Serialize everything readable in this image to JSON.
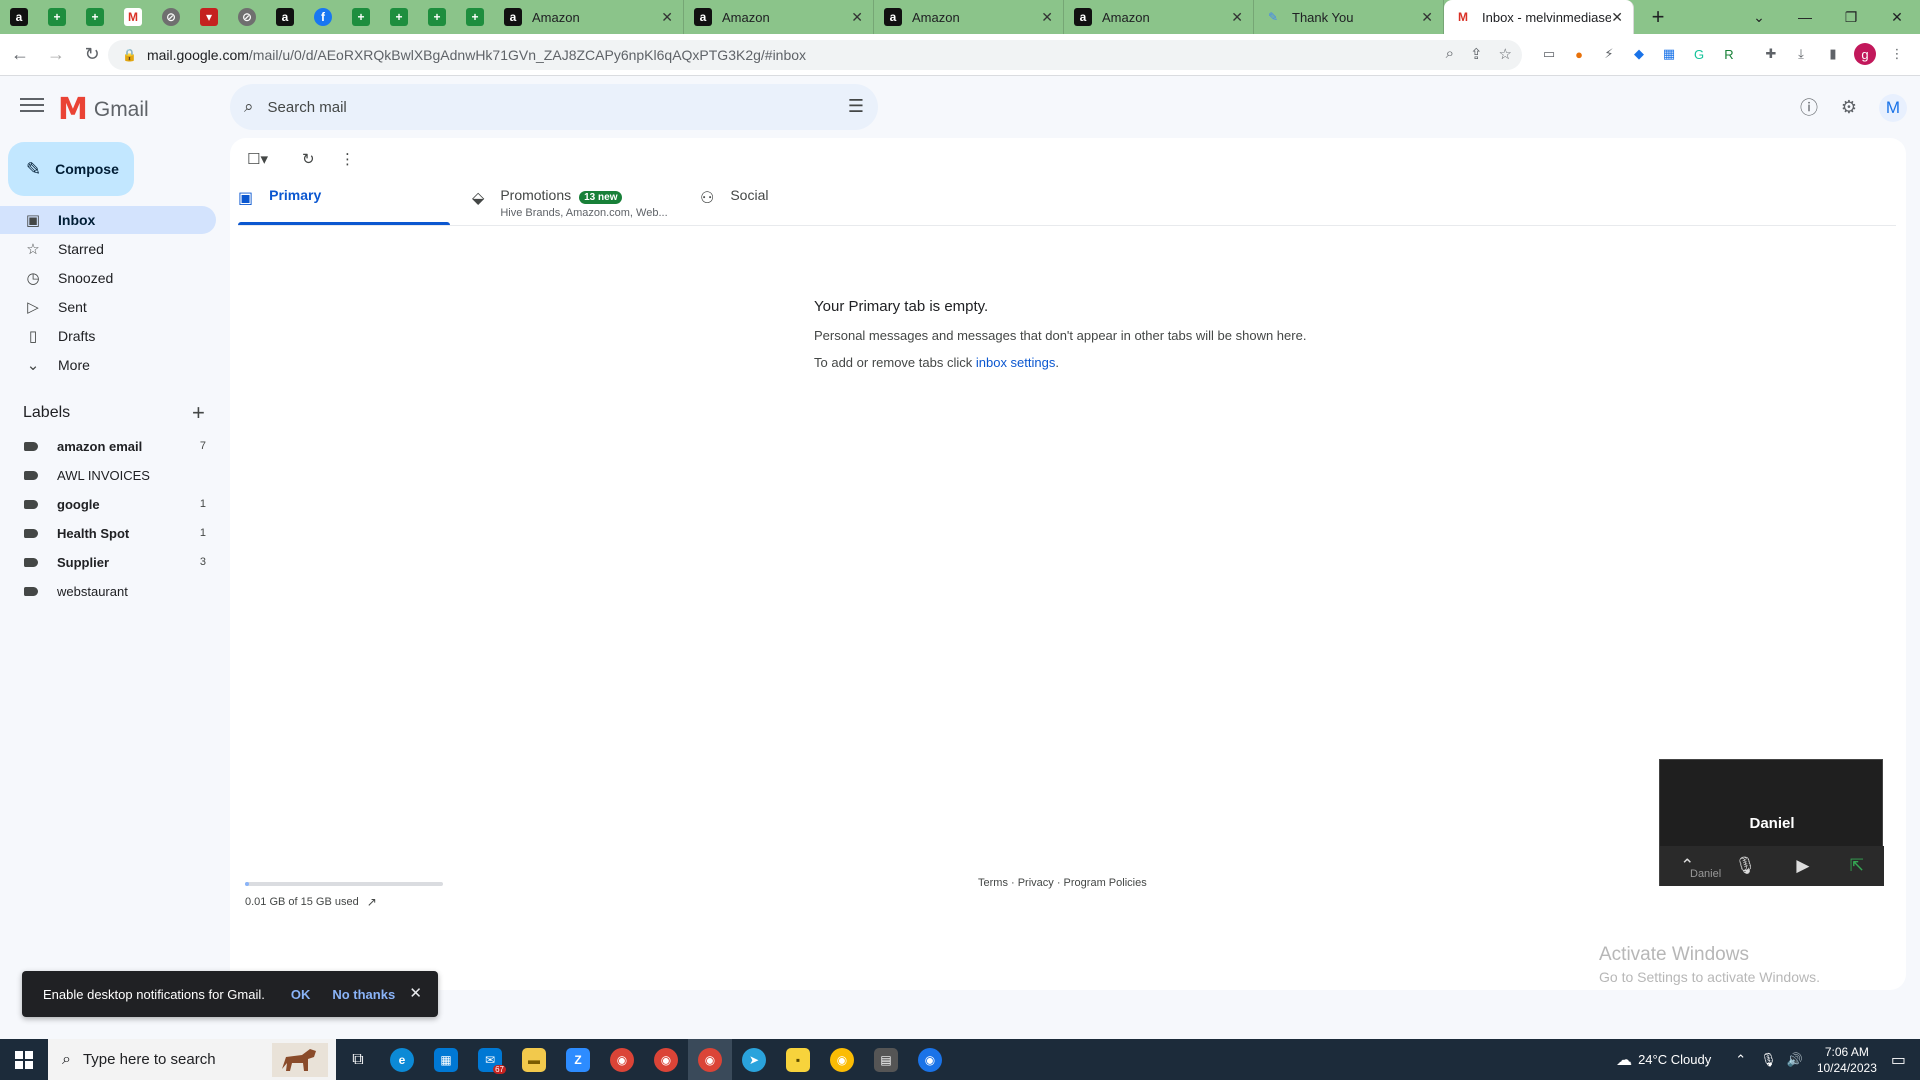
{
  "browser": {
    "pinned_tabs": [
      {
        "icon": "amazon-icon",
        "glyph": "a"
      },
      {
        "icon": "sheets-icon",
        "glyph": "+"
      },
      {
        "icon": "sheets-icon",
        "glyph": "+"
      },
      {
        "icon": "gmail-icon",
        "glyph": "M"
      },
      {
        "icon": "blocked-icon",
        "glyph": "⊘"
      },
      {
        "icon": "red-app-icon",
        "glyph": "▾"
      },
      {
        "icon": "blocked-icon",
        "glyph": "⊘"
      },
      {
        "icon": "amazon-icon",
        "glyph": "a"
      },
      {
        "icon": "facebook-icon",
        "glyph": "f"
      },
      {
        "icon": "sheets-icon",
        "glyph": "+"
      },
      {
        "icon": "sheets-icon",
        "glyph": "+"
      },
      {
        "icon": "sheets-icon",
        "glyph": "+"
      },
      {
        "icon": "sheets-icon",
        "glyph": "+"
      }
    ],
    "tabs": [
      {
        "title": "Amazon",
        "icon": "amazon-icon"
      },
      {
        "title": "Amazon",
        "icon": "amazon-icon"
      },
      {
        "title": "Amazon",
        "icon": "amazon-icon"
      },
      {
        "title": "Amazon",
        "icon": "amazon-icon"
      },
      {
        "title": "Thank You",
        "icon": "pen-icon"
      },
      {
        "title": "Inbox - melvinmediase",
        "icon": "gmail-icon",
        "active": true
      }
    ],
    "new_tab": "+",
    "url_host": "mail.google.com",
    "url_path": "/mail/u/0/d/AEoRXRQkBwlXBgAdnwHk71GVn_ZAJ8ZCAPy6npKl6qAQxPTG3K2g/#inbox",
    "profile_initial": "g"
  },
  "gmail": {
    "logo_text": "Gmail",
    "search_placeholder": "Search mail",
    "avatar_initial": "M",
    "compose_label": "Compose",
    "nav": [
      {
        "label": "Inbox",
        "icon": "inbox-icon",
        "active": true
      },
      {
        "label": "Starred",
        "icon": "star-icon"
      },
      {
        "label": "Snoozed",
        "icon": "clock-icon"
      },
      {
        "label": "Sent",
        "icon": "send-icon"
      },
      {
        "label": "Drafts",
        "icon": "draft-icon"
      },
      {
        "label": "More",
        "icon": "chevron-down-icon"
      }
    ],
    "labels_title": "Labels",
    "labels": [
      {
        "name": "amazon email",
        "count": "7",
        "bold": true
      },
      {
        "name": "AWL INVOICES",
        "count": "",
        "bold": false
      },
      {
        "name": "google",
        "count": "1",
        "bold": true
      },
      {
        "name": "Health Spot",
        "count": "1",
        "bold": true
      },
      {
        "name": "Supplier",
        "count": "3",
        "bold": true
      },
      {
        "name": "webstaurant",
        "count": "",
        "bold": false
      }
    ],
    "tabs": {
      "primary": "Primary",
      "promotions": "Promotions",
      "promotions_badge": "13 new",
      "promotions_sub": "Hive Brands, Amazon.com, Web...",
      "social": "Social"
    },
    "empty": {
      "heading": "Your Primary tab is empty.",
      "line1": "Personal messages and messages that don't appear in other tabs will be shown here.",
      "line2_prefix": "To add or remove tabs click ",
      "line2_link": "inbox settings",
      "line2_suffix": "."
    },
    "storage_text": "0.01 GB of 15 GB used",
    "storage_fraction": 0.01,
    "footer": "Terms · Privacy · Program Policies"
  },
  "call": {
    "name": "Daniel",
    "small_name": "Daniel"
  },
  "activate": {
    "line1": "Activate Windows",
    "line2": "Go to Settings to activate Windows."
  },
  "snackbar": {
    "message": "Enable desktop notifications for Gmail.",
    "ok": "OK",
    "no_thanks": "No thanks"
  },
  "taskbar": {
    "search_placeholder": "Type here to search",
    "weather": "24°C  Cloudy",
    "time": "7:06 AM",
    "date": "10/24/2023",
    "mail_badge": "67"
  }
}
